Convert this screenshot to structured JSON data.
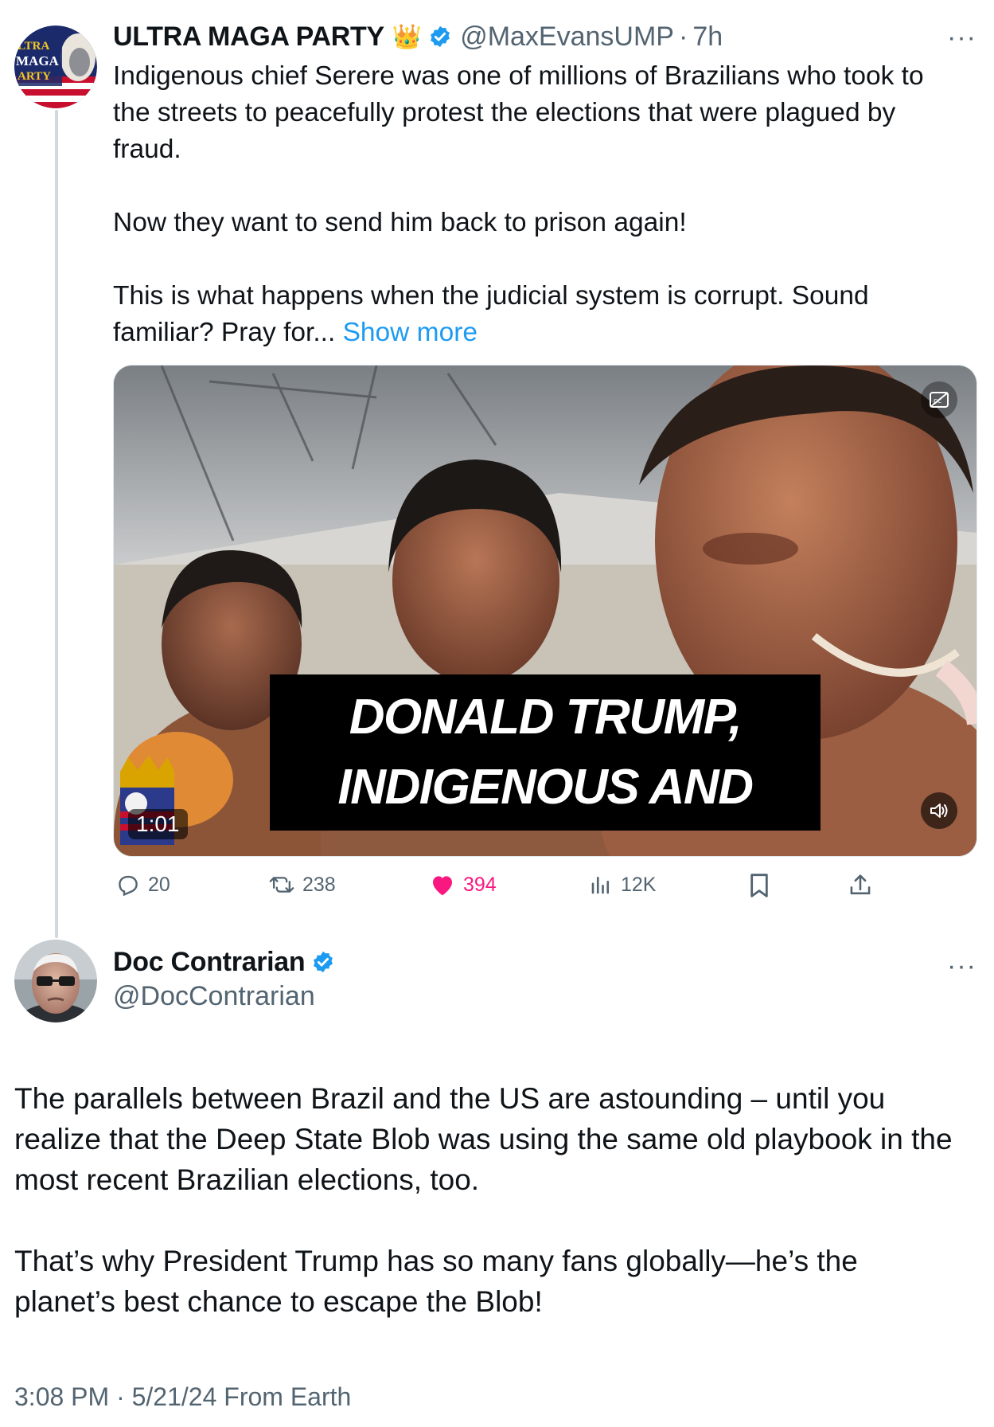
{
  "tweet": {
    "avatar_text": "ULTRA MAGA PARTY",
    "author_name": "ULTRA MAGA PARTY",
    "author_emoji": "👑",
    "handle": "@MaxEvansUMP",
    "separator": "·",
    "time_ago": "7h",
    "more_label": "···",
    "text": "Indigenous chief Serere was one of millions of Brazilians who took to\nthe streets to peacefully protest the elections that were plagued by\nfraud.\n\nNow they want to send him back to prison again!\n\nThis is what happens when the judicial system is corrupt. Sound\nfamiliar? Pray for... ",
    "show_more": "Show more",
    "media": {
      "caption_line1": "DONALD TRUMP,",
      "caption_line2": "INDIGENOUS AND",
      "duration": "1:01",
      "cc_icon": "closed-captions-off-icon",
      "sound_icon": "speaker-icon"
    },
    "actions": {
      "replies": "20",
      "reposts": "238",
      "likes": "394",
      "views": "12K"
    }
  },
  "reply": {
    "author_name": "Doc Contrarian",
    "handle": "@DocContrarian",
    "more_label": "···",
    "text": "The parallels between Brazil and the US are astounding – until you\nrealize that the Deep State Blob was using the same old playbook in the\nmost recent Brazilian elections, too.\n\nThat’s why President Trump has so many fans globally—he’s the\nplanet’s best chance to escape the Blob!",
    "timestamp": "3:08 PM · 5/21/24 From Earth"
  },
  "colors": {
    "accent_blue": "#1d9bf0",
    "like_pink": "#f91880",
    "muted_gray": "#536471",
    "text": "#0f1419"
  }
}
